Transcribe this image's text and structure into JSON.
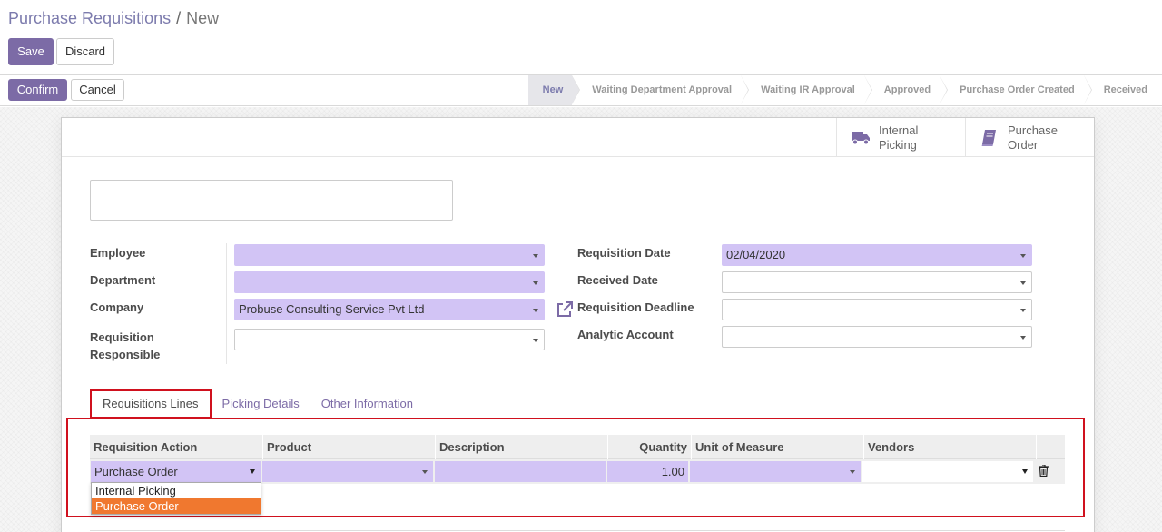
{
  "breadcrumb": {
    "parent": "Purchase Requisitions",
    "separator": "/",
    "current": "New"
  },
  "buttons": {
    "save": "Save",
    "discard": "Discard",
    "confirm": "Confirm",
    "cancel": "Cancel"
  },
  "stages": [
    {
      "label": "New",
      "current": true
    },
    {
      "label": "Waiting Department Approval",
      "current": false
    },
    {
      "label": "Waiting IR Approval",
      "current": false
    },
    {
      "label": "Approved",
      "current": false
    },
    {
      "label": "Purchase Order Created",
      "current": false
    },
    {
      "label": "Received",
      "current": false
    }
  ],
  "smart_buttons": [
    {
      "label": "Internal Picking",
      "icon": "truck-icon"
    },
    {
      "label": "Purchase Order",
      "icon": "book-icon"
    }
  ],
  "left_fields": {
    "employee": {
      "label": "Employee",
      "value": ""
    },
    "department": {
      "label": "Department",
      "value": ""
    },
    "company": {
      "label": "Company",
      "value": "Probuse Consulting Service Pvt Ltd"
    },
    "responsible": {
      "label": "Requisition Responsible",
      "value": ""
    }
  },
  "right_fields": {
    "req_date": {
      "label": "Requisition Date",
      "value": "02/04/2020"
    },
    "received_date": {
      "label": "Received Date",
      "value": ""
    },
    "deadline": {
      "label": "Requisition Deadline",
      "value": ""
    },
    "analytic": {
      "label": "Analytic Account",
      "value": ""
    }
  },
  "tabs": [
    "Requisitions Lines",
    "Picking Details",
    "Other Information"
  ],
  "table": {
    "columns": [
      "Requisition Action",
      "Product",
      "Description",
      "Quantity",
      "Unit of Measure",
      "Vendors"
    ],
    "row": {
      "action": "Purchase Order",
      "product": "",
      "description": "",
      "quantity": "1.00",
      "uom": "",
      "vendors": ""
    }
  },
  "dropdown_options": [
    "Internal Picking",
    "Purchase Order"
  ],
  "colors": {
    "primary": "#7c6ba6",
    "required": "#d2c4f5",
    "highlight": "#d0111e",
    "selected_option": "#f0782f"
  }
}
